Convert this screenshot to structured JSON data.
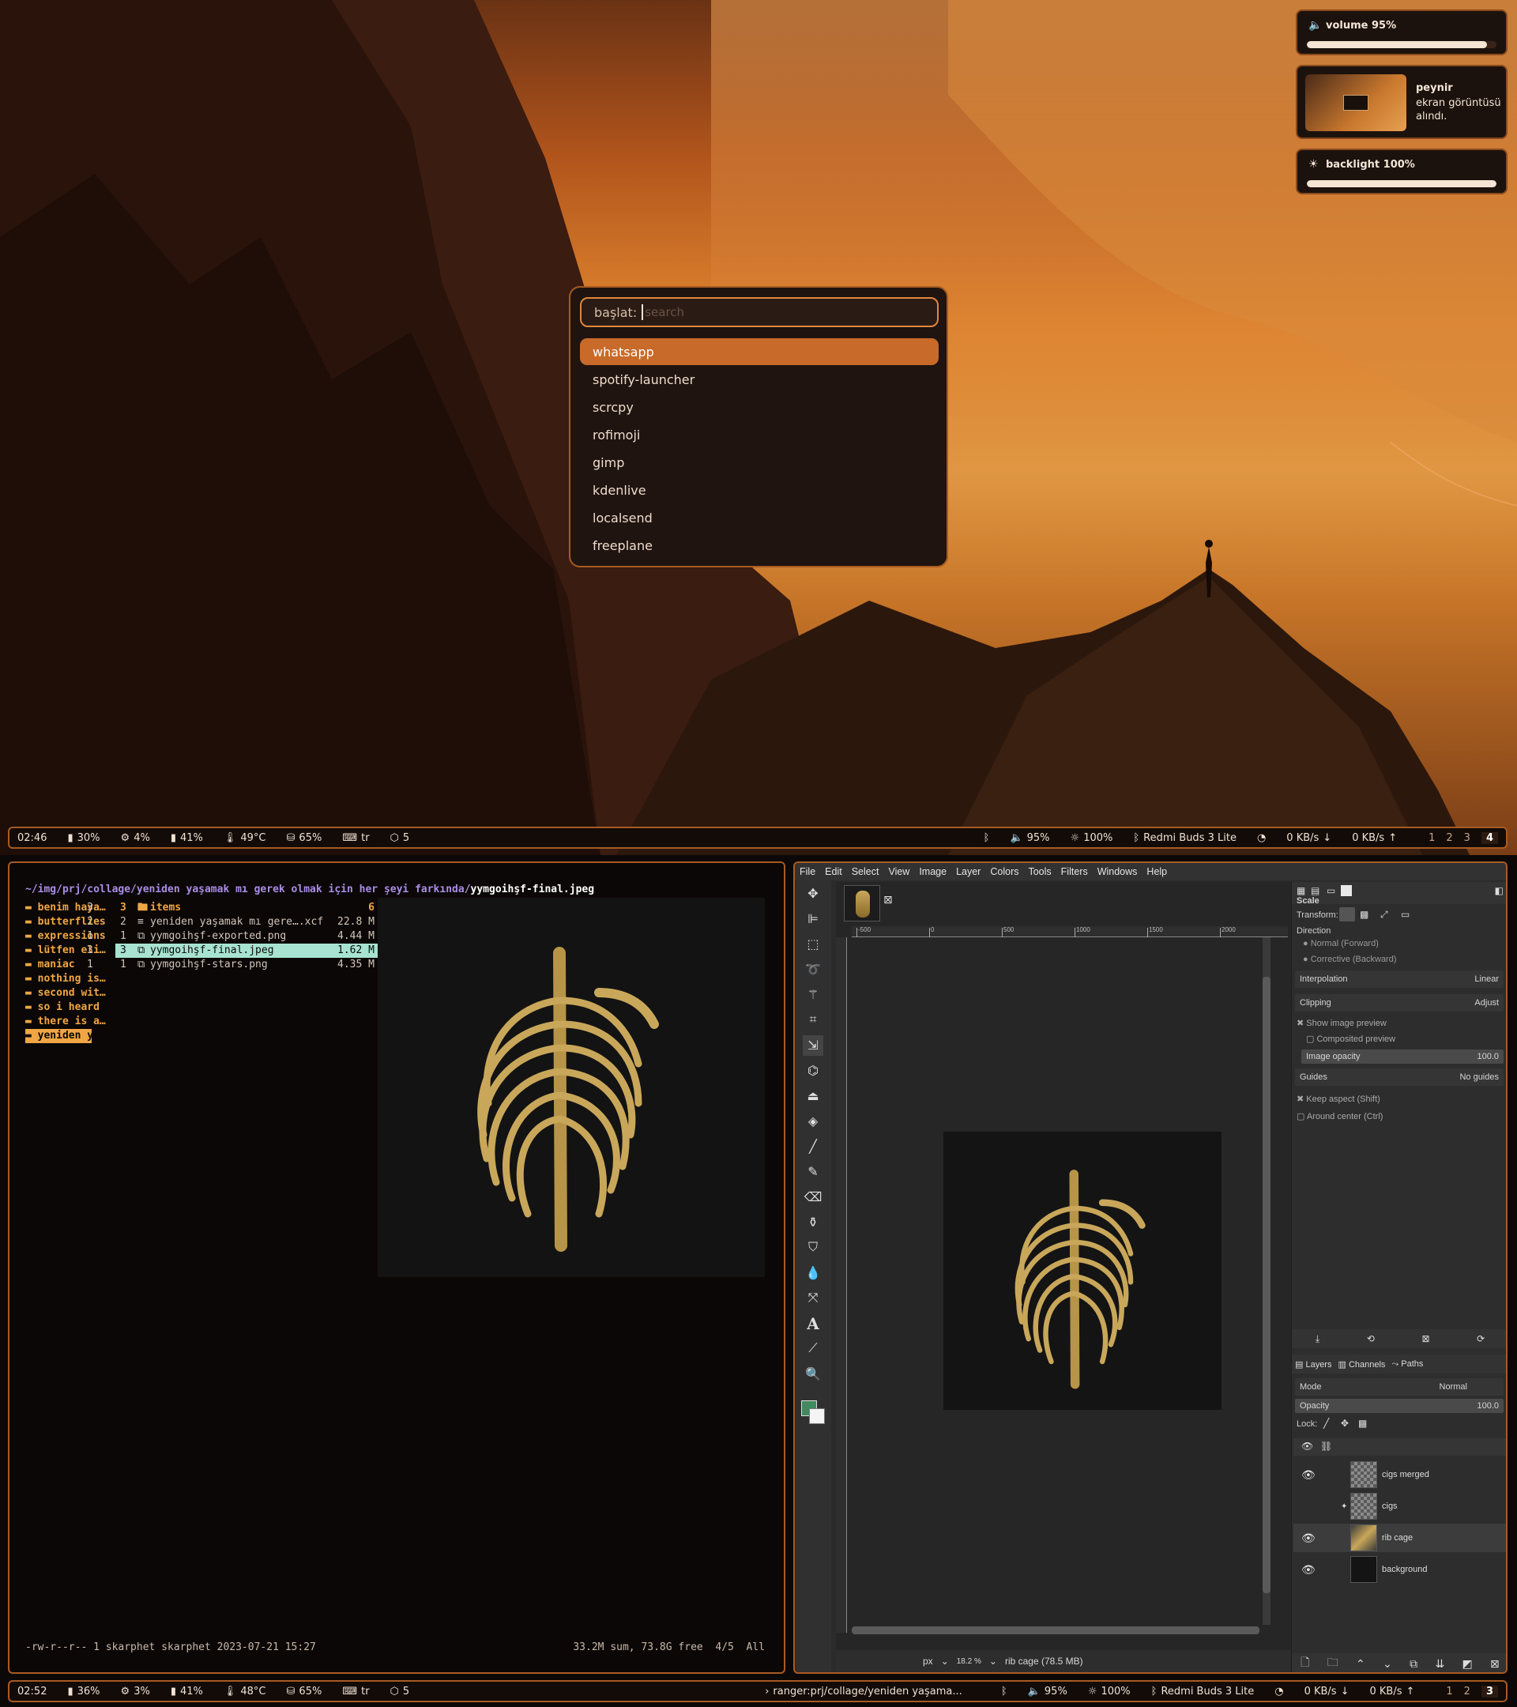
{
  "top_bar": {
    "time": "02:46",
    "battery": "30%",
    "cpu": "4%",
    "memory": "41%",
    "temp": "49°C",
    "disk": "65%",
    "keyboard": "tr",
    "packages": "5",
    "volume": "95%",
    "brightness": "100%",
    "bluetooth_device": "Redmi Buds 3 Lite",
    "net_down": "0 KB/s",
    "net_up": "0 KB/s",
    "workspaces": [
      "1",
      "2",
      "3",
      "4"
    ],
    "active_workspace": "4"
  },
  "bottom_bar": {
    "time": "02:52",
    "battery": "36%",
    "cpu": "3%",
    "memory": "41%",
    "temp": "48°C",
    "disk": "65%",
    "keyboard": "tr",
    "packages": "5",
    "window_title": "ranger:prj/collage/yeniden yaşama...",
    "volume": "95%",
    "brightness": "100%",
    "bluetooth_device": "Redmi Buds 3 Lite",
    "net_down": "0 KB/s",
    "net_up": "0 KB/s",
    "workspaces": [
      "1",
      "2",
      "3"
    ],
    "active_workspace": "3"
  },
  "notifications": {
    "volume": {
      "label": "volume 95%",
      "level": 0.95
    },
    "screenshot": {
      "app": "peynir",
      "body": "ekran görüntüsü alındı."
    },
    "backlight": {
      "label": "backlight 100%",
      "level": 1.0
    }
  },
  "launcher": {
    "prompt": "başlat:",
    "placeholder": "search",
    "items": [
      "whatsapp",
      "spotify-launcher",
      "scrcpy",
      "rofimoji",
      "gimp",
      "kdenlive",
      "localsend",
      "freeplane"
    ],
    "selected": "whatsapp"
  },
  "ranger": {
    "path_prefix": "~/img/prj/collage/yeniden yaşamak mı gerek olmak için her şeyi farkında/",
    "path_file": "yymgoihşf-final.jpeg",
    "parent_dirs": [
      "benim haya…",
      "butterflies",
      "expressions",
      "lütfen eli…",
      "maniac",
      "nothing is…",
      "second wit…",
      "so i heard",
      "there is a…",
      "yeniden ya…"
    ],
    "current_entries": [
      {
        "num": "3",
        "icon": "🖿",
        "name": "items",
        "size": "6"
      },
      {
        "num": "2",
        "icon": "≡",
        "name": "yeniden yaşamak mı gere….xcf",
        "size": "22.8 M"
      },
      {
        "num": "1",
        "icon": "⧉",
        "name": "yymgoihşf-exported.png",
        "size": "4.44 M"
      },
      {
        "num": "3",
        "icon": "⧉",
        "name": "yymgoihşf-final.jpeg",
        "size": "1.62 M"
      },
      {
        "num": "1",
        "icon": "⧉",
        "name": "yymgoihşf-stars.png",
        "size": "4.35 M"
      }
    ],
    "parent_counts": [
      "3",
      "2",
      "1",
      "3",
      "1"
    ],
    "status_left": "-rw-r--r-- 1 skarphet skarphet 2023-07-21 15:27",
    "status_right": "33.2M sum, 73.8G free  4/5  All"
  },
  "gimp": {
    "menu": [
      "File",
      "Edit",
      "Select",
      "View",
      "Image",
      "Layer",
      "Colors",
      "Tools",
      "Filters",
      "Windows",
      "Help"
    ],
    "ruler_marks": [
      "-500",
      "0",
      "500",
      "1000",
      "1500",
      "2000"
    ],
    "tool_options": {
      "title": "Scale",
      "transform_label": "Transform:",
      "direction_label": "Direction",
      "direction_normal": "Normal (Forward)",
      "direction_corrective": "Corrective (Backward)",
      "interpolation_label": "Interpolation",
      "interpolation_value": "Linear",
      "clipping_label": "Clipping",
      "clipping_value": "Adjust",
      "show_preview": "Show image preview",
      "composited_preview": "Composited preview",
      "image_opacity_label": "Image opacity",
      "image_opacity_value": "100.0",
      "guides_label": "Guides",
      "guides_value": "No guides",
      "keep_aspect": "Keep aspect (Shift)",
      "around_center": "Around center (Ctrl)"
    },
    "layers_tabs": [
      "Layers",
      "Channels",
      "Paths"
    ],
    "mode_label": "Mode",
    "mode_value": "Normal",
    "opacity_label": "Opacity",
    "opacity_value": "100.0",
    "lock_label": "Lock:",
    "layers": [
      "cigs merged",
      "cigs",
      "rib cage",
      "background"
    ],
    "selected_layer": "rib cage",
    "status_unit": "px",
    "status_zoom": "18.2 %",
    "status_info": "rib cage (78.5 MB)"
  },
  "colors": {
    "accent": "#c86a2a",
    "bar_border": "#a85a22",
    "fg_color": "#3f8a5e"
  }
}
